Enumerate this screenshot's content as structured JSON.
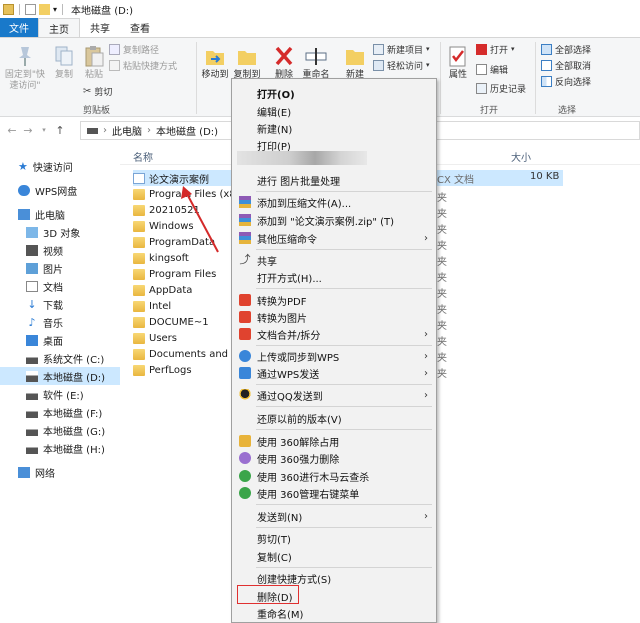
{
  "window": {
    "title": "本地磁盘 (D:)"
  },
  "tabs": [
    "文件",
    "主页",
    "共享",
    "查看"
  ],
  "ribbon": {
    "pin": "固定到\"快\n速访问\"",
    "copy": "复制",
    "paste": "粘贴",
    "copy_path": "复制路径",
    "paste_shortcut": "粘贴快捷方式",
    "cut": "剪切",
    "clipboard_group": "剪贴板",
    "move_to": "移动到",
    "copy_to": "复制到",
    "delete": "删除",
    "rename": "重命名",
    "new_folder": "新建",
    "new_item": "新建项目",
    "easy_access": "轻松访问",
    "properties": "属性",
    "open": "打开",
    "edit": "编辑",
    "history": "历史记录",
    "open_group": "打开",
    "select_all": "全部选择",
    "select_none": "全部取消",
    "invert_select": "反向选择",
    "select_group": "选择"
  },
  "address": {
    "pc": "此电脑",
    "drive": "本地磁盘 (D:)"
  },
  "nav": {
    "quick_access": "快速访问",
    "wps": "WPS网盘",
    "this_pc": "此电脑",
    "items": [
      "3D 对象",
      "视频",
      "图片",
      "文档",
      "下载",
      "音乐",
      "桌面",
      "系统文件 (C:)",
      "本地磁盘 (D:)",
      "软件 (E:)",
      "本地磁盘 (F:)",
      "本地磁盘 (G:)",
      "本地磁盘 (H:)"
    ],
    "network": "网络"
  },
  "files": {
    "col_name": "名称",
    "col_size": "大小",
    "first": {
      "name": "论文演示案例",
      "type": "CX 文档",
      "size": "10 KB"
    },
    "folders": [
      "Program Files (x86)",
      "20210521",
      "Windows",
      "ProgramData",
      "kingsoft",
      "Program Files",
      "AppData",
      "Intel",
      "DOCUME~1",
      "Users",
      "Documents and Se",
      "PerfLogs"
    ],
    "type_partial": "夹"
  },
  "menu": {
    "open": "打开(O)",
    "edit": "编辑(E)",
    "new": "新建(N)",
    "print": "打印(P)",
    "batch_image": "进行 图片批量处理",
    "add_archive": "添加到压缩文件(A)...",
    "add_zip": "添加到 \"论文演示案例.zip\" (T)",
    "other_zip": "其他压缩命令",
    "share": "共享",
    "open_with": "打开方式(H)...",
    "to_pdf": "转换为PDF",
    "to_image": "转换为图片",
    "merge_split": "文档合并/拆分",
    "upload_wps": "上传或同步到WPS",
    "send_wps": "通过WPS发送",
    "send_qq": "通过QQ发送到",
    "restore": "还原以前的版本(V)",
    "unlock_360": "使用 360解除占用",
    "force_del_360": "使用 360强力删除",
    "scan_360": "使用 360进行木马云查杀",
    "menu_360": "使用 360管理右键菜单",
    "send_to": "发送到(N)",
    "cut": "剪切(T)",
    "copy": "复制(C)",
    "create_shortcut": "创建快捷方式(S)",
    "delete": "删除(D)",
    "rename": "重命名(M)"
  },
  "colors": {
    "accent": "#1979ca",
    "selection": "#cce8ff",
    "highlight_box": "#e03030"
  }
}
